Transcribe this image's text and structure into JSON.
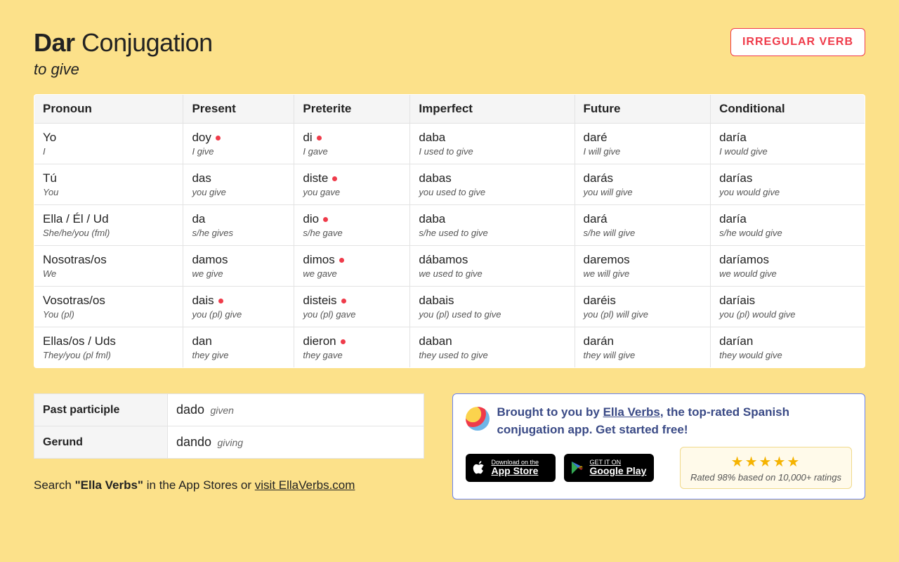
{
  "header": {
    "verb": "Dar",
    "word_conjugation": "Conjugation",
    "translation": "to give",
    "badge": "IRREGULAR VERB"
  },
  "columns": [
    "Pronoun",
    "Present",
    "Preterite",
    "Imperfect",
    "Future",
    "Conditional"
  ],
  "pronouns": [
    {
      "es": "Yo",
      "en": "I"
    },
    {
      "es": "Tú",
      "en": "You"
    },
    {
      "es": "Ella / Él / Ud",
      "en": "She/he/you (fml)"
    },
    {
      "es": "Nosotras/os",
      "en": "We"
    },
    {
      "es": "Vosotras/os",
      "en": "You (pl)"
    },
    {
      "es": "Ellas/os / Uds",
      "en": "They/you (pl fml)"
    }
  ],
  "rows": [
    [
      {
        "es": "doy",
        "en": "I give",
        "irr": true
      },
      {
        "es": "di",
        "en": "I gave",
        "irr": true
      },
      {
        "es": "daba",
        "en": "I used to give",
        "irr": false
      },
      {
        "es": "daré",
        "en": "I will give",
        "irr": false
      },
      {
        "es": "daría",
        "en": "I would give",
        "irr": false
      }
    ],
    [
      {
        "es": "das",
        "en": "you give",
        "irr": false
      },
      {
        "es": "diste",
        "en": "you gave",
        "irr": true
      },
      {
        "es": "dabas",
        "en": "you used to give",
        "irr": false
      },
      {
        "es": "darás",
        "en": "you will give",
        "irr": false
      },
      {
        "es": "darías",
        "en": "you would give",
        "irr": false
      }
    ],
    [
      {
        "es": "da",
        "en": "s/he gives",
        "irr": false
      },
      {
        "es": "dio",
        "en": "s/he gave",
        "irr": true
      },
      {
        "es": "daba",
        "en": "s/he used to give",
        "irr": false
      },
      {
        "es": "dará",
        "en": "s/he will give",
        "irr": false
      },
      {
        "es": "daría",
        "en": "s/he would give",
        "irr": false
      }
    ],
    [
      {
        "es": "damos",
        "en": "we give",
        "irr": false
      },
      {
        "es": "dimos",
        "en": "we gave",
        "irr": true
      },
      {
        "es": "dábamos",
        "en": "we used to give",
        "irr": false
      },
      {
        "es": "daremos",
        "en": "we will give",
        "irr": false
      },
      {
        "es": "daríamos",
        "en": "we would give",
        "irr": false
      }
    ],
    [
      {
        "es": "dais",
        "en": "you (pl) give",
        "irr": true
      },
      {
        "es": "disteis",
        "en": "you (pl) gave",
        "irr": true
      },
      {
        "es": "dabais",
        "en": "you (pl) used to give",
        "irr": false
      },
      {
        "es": "daréis",
        "en": "you (pl) will give",
        "irr": false
      },
      {
        "es": "daríais",
        "en": "you (pl) would give",
        "irr": false
      }
    ],
    [
      {
        "es": "dan",
        "en": "they give",
        "irr": false
      },
      {
        "es": "dieron",
        "en": "they gave",
        "irr": true
      },
      {
        "es": "daban",
        "en": "they used to give",
        "irr": false
      },
      {
        "es": "darán",
        "en": "they will give",
        "irr": false
      },
      {
        "es": "darían",
        "en": "they would give",
        "irr": false
      }
    ]
  ],
  "participles": [
    {
      "label": "Past participle",
      "es": "dado",
      "en": "given"
    },
    {
      "label": "Gerund",
      "es": "dando",
      "en": "giving"
    }
  ],
  "search_note": {
    "prefix": "Search ",
    "quoted": "\"Ella Verbs\"",
    "mid": " in the App Stores or ",
    "link": "visit EllaVerbs.com"
  },
  "promo": {
    "line1_a": "Brought to you by ",
    "link": "Ella Verbs",
    "line1_b": ", the top-rated Spanish conjugation app. Get started free!",
    "appstore_small": "Download on the",
    "appstore_big": "App Store",
    "play_small": "GET IT ON",
    "play_big": "Google Play",
    "rating_text": "Rated 98% based on 10,000+ ratings"
  }
}
